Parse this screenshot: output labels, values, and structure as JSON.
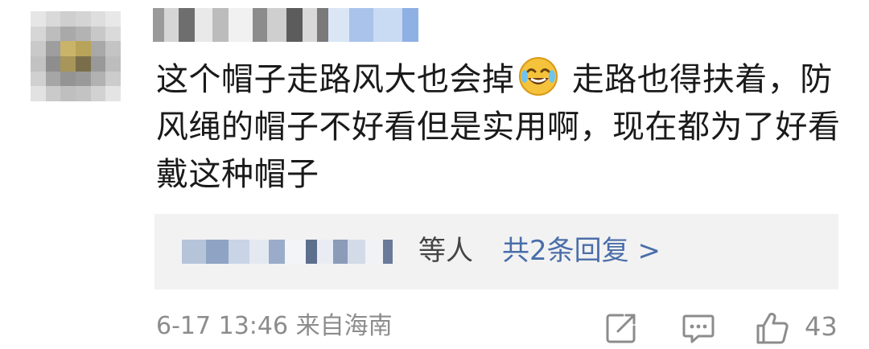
{
  "comment": {
    "text_part1": "这个帽子走路风大也会掉",
    "emoji": "laughing-tears-emoji",
    "text_part2": " 走路也得扶着，防风绳的帽子不好看但是实用啊，现在都为了好看戴这种帽子"
  },
  "reply_summary": {
    "suffix": "等人",
    "link": "共2条回复 >"
  },
  "footer": {
    "meta": "6-17 13:46 来自海南",
    "like_count": "43"
  },
  "colors": {
    "text": "#1a1a1a",
    "link": "#4a6ea9",
    "muted": "#8c8c8c",
    "reply_bg": "#f2f2f2"
  }
}
